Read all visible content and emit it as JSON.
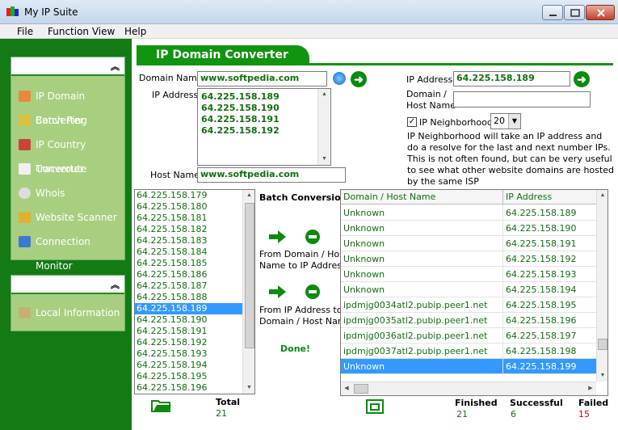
{
  "window": {
    "title": "My IP Suite"
  },
  "menu": [
    "File",
    "Function View",
    "Help"
  ],
  "sidebar": {
    "items": [
      {
        "label": "IP Domain Converter",
        "icon": "globe-icon"
      },
      {
        "label": "Batch Ping",
        "icon": "ping-icon"
      },
      {
        "label": "IP Country Converter",
        "icon": "country-icon"
      },
      {
        "label": "Traceroute",
        "icon": "traceroute-icon"
      },
      {
        "label": "Whois",
        "icon": "whois-icon"
      },
      {
        "label": "Website Scanner",
        "icon": "scanner-icon"
      },
      {
        "label": "Connection Monitor",
        "icon": "monitor-icon"
      }
    ],
    "info_item": "Local Information"
  },
  "header": {
    "title": "IP Domain Converter"
  },
  "form": {
    "domain_label": "Domain  Name",
    "domain_value": "www.softpedia.com",
    "ip_label": "IP Address",
    "ip_values": [
      "64.225.158.189",
      "64.225.158.190",
      "64.225.158.191",
      "64.225.158.192"
    ],
    "host_label": "Host Name",
    "host_value": "www.softpedia.com"
  },
  "right_form": {
    "ip_label": "IP Address",
    "ip_value": "64.225.158.189",
    "domain_label_1": "Domain /",
    "domain_label_2": "Host Name",
    "domain_value": "",
    "neighborhood_label": "IP Neighborhood",
    "neighborhood_checked": true,
    "neighborhood_value": "20",
    "note": "IP Neighborhood will take an IP address and do a resolve for the last and next number IPs. This is not often found, but can be very useful to see what other website domains are hosted by the same ISP"
  },
  "ip_list": {
    "items": [
      "64.225.158.179",
      "64.225.158.180",
      "64.225.158.181",
      "64.225.158.182",
      "64.225.158.183",
      "64.225.158.184",
      "64.225.158.185",
      "64.225.158.186",
      "64.225.158.187",
      "64.225.158.188",
      "64.225.158.189",
      "64.225.158.190",
      "64.225.158.191",
      "64.225.158.192",
      "64.225.158.193",
      "64.225.158.194",
      "64.225.158.195",
      "64.225.158.196"
    ],
    "selected_index": 10
  },
  "batch": {
    "title": "Batch Conversion",
    "to_ip_1": "From Domain / Host",
    "to_ip_2": "Name to IP Address",
    "to_domain_1": "From IP Address to",
    "to_domain_2": "Domain / Host Name",
    "status": "Done!"
  },
  "results": {
    "columns": [
      "Domain / Host Name",
      "IP Address"
    ],
    "rows": [
      [
        "Unknown",
        "64.225.158.189"
      ],
      [
        "Unknown",
        "64.225.158.190"
      ],
      [
        "Unknown",
        "64.225.158.191"
      ],
      [
        "Unknown",
        "64.225.158.192"
      ],
      [
        "Unknown",
        "64.225.158.193"
      ],
      [
        "Unknown",
        "64.225.158.194"
      ],
      [
        "ipdmjg0034atl2.pubip.peer1.net",
        "64.225.158.195"
      ],
      [
        "ipdmjg0035atl2.pubip.peer1.net",
        "64.225.158.196"
      ],
      [
        "ipdmjg0036atl2.pubip.peer1.net",
        "64.225.158.197"
      ],
      [
        "ipdmjg0037atl2.pubip.peer1.net",
        "64.225.158.198"
      ],
      [
        "Unknown",
        "64.225.158.199"
      ]
    ],
    "selected_index": 10
  },
  "footer": {
    "total_label": "Total",
    "total_value": "21",
    "finished_label": "Finished",
    "finished_value": "21",
    "successful_label": "Successful",
    "successful_value": "6",
    "failed_label": "Failed",
    "failed_value": "15"
  }
}
